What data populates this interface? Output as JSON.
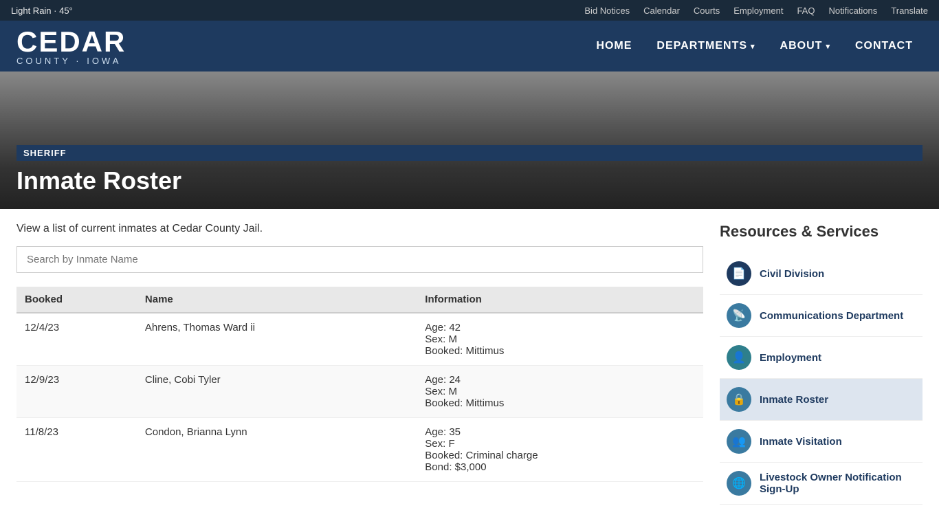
{
  "topbar": {
    "weather": "Light Rain · 45°",
    "links": [
      {
        "label": "Bid Notices",
        "name": "bid-notices-link"
      },
      {
        "label": "Calendar",
        "name": "calendar-link"
      },
      {
        "label": "Courts",
        "name": "courts-link"
      },
      {
        "label": "Employment",
        "name": "employment-top-link"
      },
      {
        "label": "FAQ",
        "name": "faq-link"
      },
      {
        "label": "Notifications",
        "name": "notifications-link"
      },
      {
        "label": "Translate",
        "name": "translate-link"
      }
    ]
  },
  "header": {
    "logo_line1": "CEDAR",
    "logo_line2": "COUNTY · IOWA",
    "nav": [
      {
        "label": "HOME",
        "name": "home-nav",
        "has_arrow": false
      },
      {
        "label": "DEPARTMENTS",
        "name": "departments-nav",
        "has_arrow": true
      },
      {
        "label": "ABOUT",
        "name": "about-nav",
        "has_arrow": true
      },
      {
        "label": "CONTACT",
        "name": "contact-nav",
        "has_arrow": false
      }
    ]
  },
  "hero": {
    "badge": "SHERIFF",
    "title": "Inmate Roster"
  },
  "main": {
    "intro": "View a list of current inmates at Cedar County Jail.",
    "search_placeholder": "Search by Inmate Name",
    "table": {
      "columns": [
        "Booked",
        "Name",
        "Information"
      ],
      "rows": [
        {
          "booked": "12/4/23",
          "name": "Ahrens, Thomas Ward ii",
          "info": "Age: 42\nSex: M\nBooked: Mittimus"
        },
        {
          "booked": "12/9/23",
          "name": "Cline, Cobi Tyler",
          "info": "Age: 24\nSex: M\nBooked: Mittimus"
        },
        {
          "booked": "11/8/23",
          "name": "Condon, Brianna Lynn",
          "info": "Age: 35\nSex: F\nBooked: Criminal charge\nBond: $3,000"
        }
      ]
    }
  },
  "sidebar": {
    "title": "Resources & Services",
    "items": [
      {
        "label": "Civil Division",
        "name": "civil-division-link",
        "icon": "📄",
        "active": false
      },
      {
        "label": "Communications Department",
        "name": "communications-link",
        "icon": "📡",
        "active": false
      },
      {
        "label": "Employment",
        "name": "employment-sidebar-link",
        "icon": "👤",
        "active": false
      },
      {
        "label": "Inmate Roster",
        "name": "inmate-roster-link",
        "icon": "🔒",
        "active": true
      },
      {
        "label": "Inmate Visitation",
        "name": "inmate-visitation-link",
        "icon": "👥",
        "active": false
      },
      {
        "label": "Livestock Owner Notification Sign-Up",
        "name": "livestock-link",
        "icon": "🌐",
        "active": false
      }
    ]
  }
}
